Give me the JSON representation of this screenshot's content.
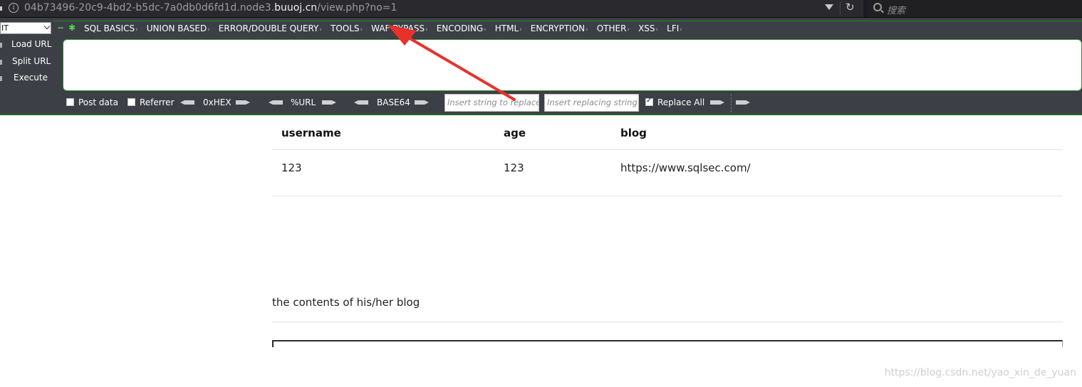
{
  "browser": {
    "url_prefix": "04b73496-20c9-4bd2-b5dc-7a0db0d6fd1d.node3.",
    "url_host": "buuoj.cn",
    "url_path": "/view.php?no=1",
    "search_placeholder": "搜索"
  },
  "hackbar": {
    "select_value": "IT",
    "icons": [
      "−",
      "✱"
    ],
    "menu": [
      "SQL BASICS",
      "UNION BASED",
      "ERROR/DOUBLE QUERY",
      "TOOLS",
      "WAF BYPASS",
      "ENCODING",
      "HTML",
      "ENCRYPTION",
      "OTHER",
      "XSS",
      "LFI"
    ],
    "side_buttons": [
      "Load URL",
      "Split URL",
      "Execute"
    ],
    "post_data_label": "Post data",
    "referrer_label": "Referrer",
    "hex_label": "0xHEX",
    "url_label": "%URL",
    "base64_label": "BASE64",
    "replace_placeholder": "Insert string to replace",
    "replacing_placeholder": "Insert replacing string",
    "replace_all_label": "Replace All",
    "post_data_checked": false,
    "referrer_checked": false,
    "replace_all_checked": true
  },
  "table": {
    "headers": [
      "username",
      "age",
      "blog"
    ],
    "row": [
      "123",
      "123",
      "https://www.sqlsec.com/"
    ]
  },
  "blog_text": "the contents of his/her blog",
  "watermark": "https://blog.csdn.net/yao_xin_de_yuan",
  "annotation_color": "#e8312b"
}
